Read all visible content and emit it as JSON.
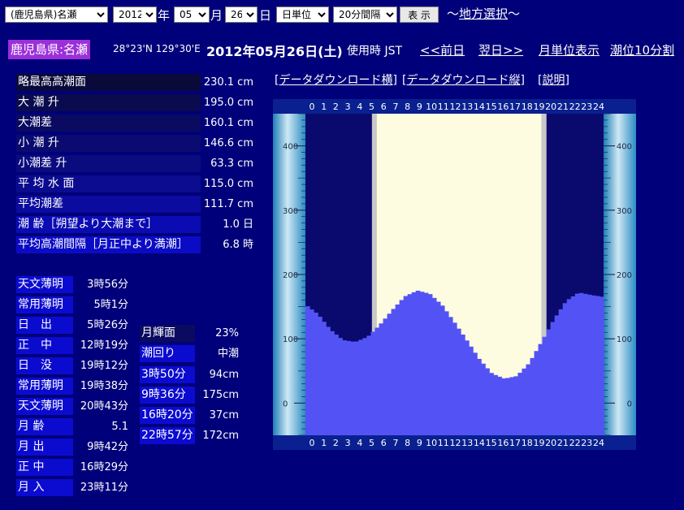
{
  "controls": {
    "prefecture_station": "(鹿児島県)名瀬",
    "year": "2012",
    "year_unit": "年",
    "month": "05",
    "month_unit": "月",
    "day": "26",
    "day_unit": "日",
    "period": "日単位",
    "interval": "20分間隔",
    "display_button": "表 示",
    "region_link": "地方選択",
    "region_prefix": "～",
    "region_suffix": "～"
  },
  "header": {
    "station": "鹿児島県:名瀬",
    "coords": "28°23'N 129°30'E",
    "date": "2012年05月26日(土)",
    "time_label": "使用時 JST",
    "prev_link": "<<前日",
    "next_link": "翌日>>",
    "month_link": "月単位表示",
    "ten_min_link": "潮位10分割"
  },
  "downloads": {
    "horizontal": "[データダウンロード横]",
    "vertical": "[データダウンロード縦]",
    "explain": "[説明]"
  },
  "tide_info": [
    {
      "label": "略最高高潮面",
      "value": "230.1 cm"
    },
    {
      "label": "大 潮 升",
      "value": "195.0 cm"
    },
    {
      "label": "大潮差",
      "value": "160.1 cm"
    },
    {
      "label": "小 潮 升",
      "value": "146.6 cm"
    },
    {
      "label": "小潮差 升",
      "value": "63.3 cm"
    },
    {
      "label": "平 均 水 面",
      "value": "115.0 cm"
    },
    {
      "label": "平均潮差",
      "value": "111.7 cm"
    },
    {
      "label": "潮 齢［朔望より大潮まで］",
      "value": "1.0 日"
    },
    {
      "label": "平均高潮間隔［月正中より満潮］",
      "value": "6.8 時"
    }
  ],
  "sun_moon": [
    {
      "label": "天文薄明",
      "value": "3時56分"
    },
    {
      "label": "常用薄明",
      "value": "5時1分"
    },
    {
      "label": "日　出",
      "value": "5時26分"
    },
    {
      "label": "正　中",
      "value": "12時19分"
    },
    {
      "label": "日　没",
      "value": "19時12分"
    },
    {
      "label": "常用薄明",
      "value": "19時38分"
    },
    {
      "label": "天文薄明",
      "value": "20時43分"
    },
    {
      "label": "月 齢",
      "value": "5.1"
    },
    {
      "label": "月 出",
      "value": "9時42分"
    },
    {
      "label": "正 中",
      "value": "16時29分"
    },
    {
      "label": "月 入",
      "value": "23時11分"
    }
  ],
  "moon_info": [
    {
      "label": "月輝面",
      "value": "23%"
    },
    {
      "label": "潮回り",
      "value": "中潮"
    }
  ],
  "extremes": [
    {
      "label": "3時50分",
      "value": "94cm"
    },
    {
      "label": "9時36分",
      "value": "175cm"
    },
    {
      "label": "16時20分",
      "value": "37cm"
    },
    {
      "label": "22時57分",
      "value": "172cm"
    }
  ],
  "colors": {
    "background": "#00007a",
    "night": "#0a0a6e",
    "day": "#fdfbe0",
    "twilight": "#c8c8c8",
    "water": "#5353f5",
    "station_badge": "#9b30d8"
  },
  "icons": {
    "moon": "crescent-moon-icon"
  },
  "chart_data": {
    "type": "area",
    "x_ticks": [
      "0",
      "1",
      "2",
      "3",
      "4",
      "5",
      "6",
      "7",
      "8",
      "9",
      "10",
      "11",
      "12",
      "13",
      "14",
      "15",
      "16",
      "17",
      "18",
      "19",
      "20",
      "21",
      "22",
      "23",
      "24"
    ],
    "y_ticks": [
      "400",
      "300",
      "200",
      "100",
      "0"
    ],
    "ylim": [
      -50,
      450
    ],
    "xlim": [
      0,
      24
    ],
    "x": [
      0,
      1,
      2,
      3,
      4,
      5,
      6,
      7,
      8,
      9,
      10,
      11,
      12,
      13,
      14,
      15,
      16,
      17,
      18,
      19,
      20,
      21,
      22,
      23,
      24
    ],
    "values": [
      153,
      138,
      114,
      98,
      95,
      103,
      122,
      145,
      166,
      175,
      170,
      152,
      125,
      97,
      68,
      46,
      38,
      42,
      62,
      95,
      130,
      159,
      172,
      168,
      165
    ],
    "sunrise_hour": 5.43,
    "sunset_hour": 19.2,
    "civil_dawn_hour": 5.02,
    "civil_dusk_hour": 19.63
  }
}
